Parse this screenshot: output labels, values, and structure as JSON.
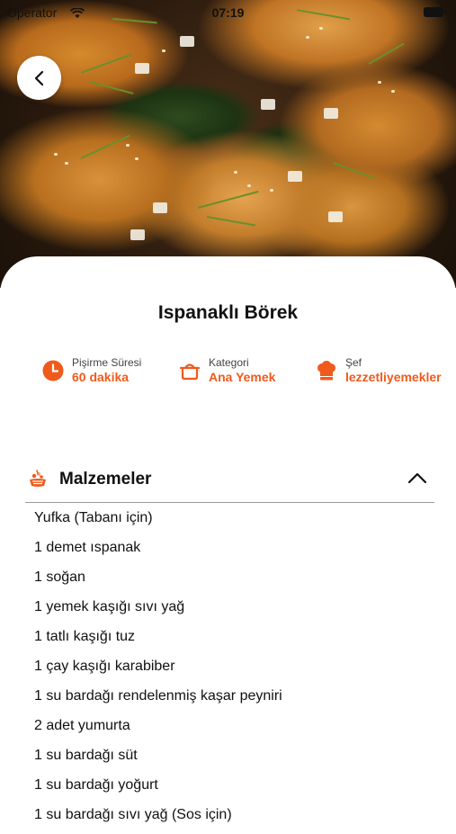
{
  "status_bar": {
    "carrier": "Operator",
    "time": "07:19"
  },
  "recipe": {
    "title": "Ispanaklı Börek",
    "meta": [
      {
        "label": "Pişirme Süresi",
        "value": "60 dakika",
        "icon": "clock-icon"
      },
      {
        "label": "Kategori",
        "value": "Ana Yemek",
        "icon": "pot-icon"
      },
      {
        "label": "Şef",
        "value": "lezzetliyemekler",
        "icon": "chef-hat-icon"
      }
    ]
  },
  "ingredients_section": {
    "title": "Malzemeler",
    "icon": "ingredients-icon",
    "expanded": true,
    "items": [
      "Yufka (Tabanı için)",
      "1 demet ıspanak",
      "1 soğan",
      "1 yemek kaşığı sıvı yağ",
      "1 tatlı kaşığı tuz",
      "1 çay kaşığı karabiber",
      "1 su bardağı rendelenmiş kaşar peyniri",
      "2 adet yumurta",
      "1 su bardağı süt",
      "1 su bardağı yoğurt",
      "1 su bardağı sıvı yağ (Sos için)"
    ]
  },
  "colors": {
    "accent": "#f05a1c",
    "text": "#111111",
    "divider": "#9a9a9a"
  }
}
